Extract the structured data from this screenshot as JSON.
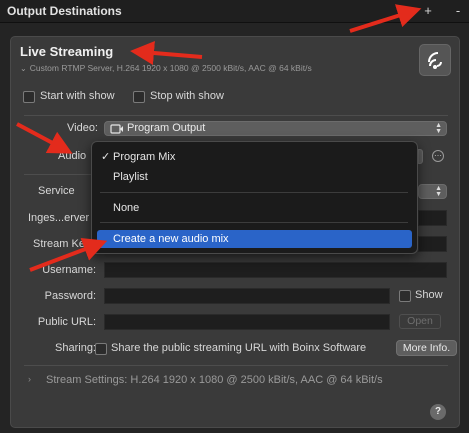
{
  "window": {
    "title": "Output Destinations",
    "add_label": "+",
    "remove_label": "-"
  },
  "stream": {
    "title": "Live Streaming",
    "subtitle": "Custom RTMP Server, H.264 1920 x 1080 @ 2500 kBit/s, AAC @ 64 kBit/s"
  },
  "options": {
    "start_with_show": "Start with show",
    "stop_with_show": "Stop with show"
  },
  "fields": {
    "video_label": "Video:",
    "video_value": "Program Output",
    "audio_label": "Audio",
    "service_label": "Service",
    "ingest_label": "Inges...erver",
    "stream_key_label": "Stream Ke",
    "username_label": "Username:",
    "password_label": "Password:",
    "show_label": "Show",
    "public_url_label": "Public URL:",
    "open_label": "Open",
    "sharing_label": "Sharing:",
    "sharing_text": "Share the public streaming URL with Boinx Software",
    "more_info_label": "More Info."
  },
  "audio_menu": {
    "items": [
      "Program Mix",
      "Playlist",
      "None",
      "Create a new audio mix"
    ],
    "checked_item": "Program Mix",
    "highlighted_item": "Create a new audio mix"
  },
  "stream_settings": "Stream Settings: H.264 1920 x 1080 @ 2500 kBit/s, AAC @ 64 kBit/s",
  "help_label": "?",
  "colors": {
    "annotation_arrow": "#e32b1c",
    "menu_highlight": "#2a64c8"
  }
}
